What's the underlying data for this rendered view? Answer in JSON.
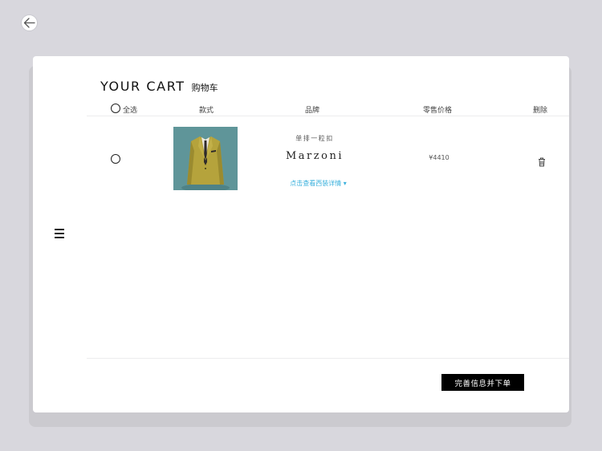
{
  "nav": {
    "back_icon": "arrow-left-icon",
    "menu_icon": "hamburger-menu-icon"
  },
  "cart": {
    "title_en": "YOUR CART",
    "title_zh": "购物车",
    "columns": {
      "select_all": "全选",
      "style": "款式",
      "brand": "品牌",
      "retail_price": "零售价格",
      "delete": "删除"
    },
    "items": [
      {
        "selected": false,
        "image": "yellow-suit-jacket",
        "style_name": "单排一粒扣",
        "brand": "Marzoni",
        "detail_link": "点击查看西装详情",
        "price": "¥4410",
        "delete_icon": "trash-icon"
      }
    ],
    "checkout_label": "完善信息并下单"
  },
  "colors": {
    "background": "#d8d7dd",
    "card": "#ffffff",
    "link": "#3ab0dc",
    "button": "#000000",
    "thumbnail_bg": "#5f9599",
    "jacket": "#b5a33c"
  }
}
